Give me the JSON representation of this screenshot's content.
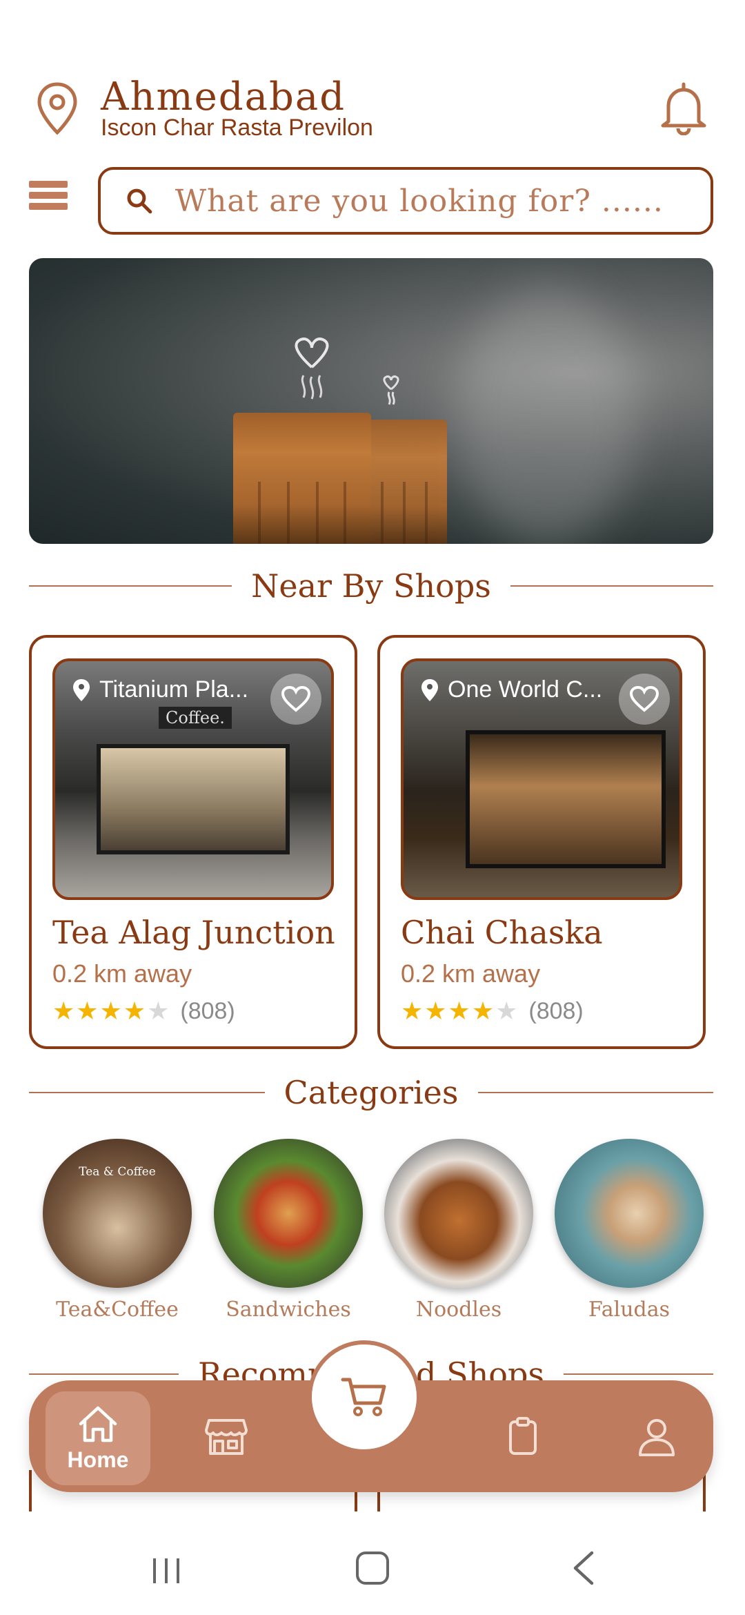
{
  "header": {
    "city": "Ahmedabad",
    "address": "Iscon Char Rasta Previlon"
  },
  "search": {
    "placeholder": "What are you looking for? ......"
  },
  "sections": {
    "nearby_title": "Near By Shops",
    "categories_title": "Categories",
    "recommended_title": "Recommended Shops"
  },
  "nearby_shops": [
    {
      "location": "Titanium Pla...",
      "sign": "Coffee.",
      "name": "Tea Alag Junction",
      "distance": "0.2 km away",
      "rating": 4,
      "reviews": "(808)"
    },
    {
      "location": "One World C...",
      "name": "Chai Chaska",
      "distance": "0.2 km away",
      "rating": 4,
      "reviews": "(808)"
    }
  ],
  "categories": [
    {
      "label": "Tea&Coffee",
      "image_text": "Tea & Coffee"
    },
    {
      "label": "Sandwiches"
    },
    {
      "label": "Noodles"
    },
    {
      "label": "Faludas"
    }
  ],
  "bottom_nav": {
    "home_label": "Home",
    "items": [
      "home-icon",
      "store-icon",
      "cart-icon",
      "orders-icon",
      "profile-icon"
    ],
    "active": "Home"
  },
  "colors": {
    "brand": "#8a3a12",
    "nav_bg": "#bf7b5e",
    "star": "#f5b400"
  }
}
